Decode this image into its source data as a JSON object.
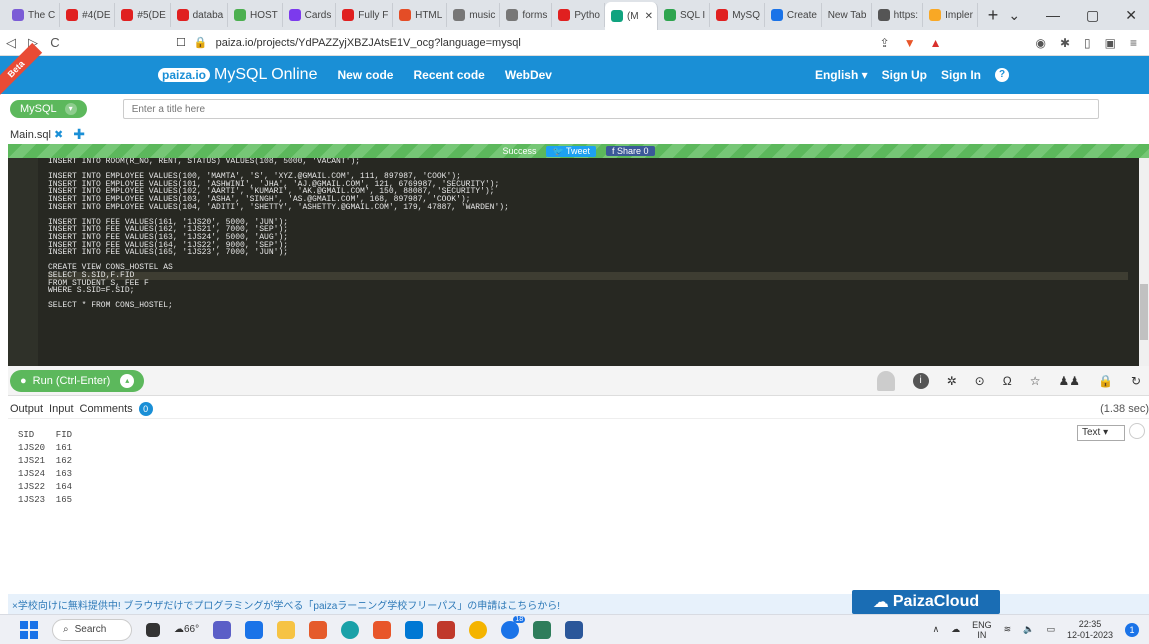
{
  "browser": {
    "tabs": [
      {
        "label": "The C",
        "color": "#7b5cd6"
      },
      {
        "label": "#4(DE",
        "color": "#e02020"
      },
      {
        "label": "#5(DE",
        "color": "#e02020"
      },
      {
        "label": "databa",
        "color": "#e02020"
      },
      {
        "label": "HOST",
        "color": "#4caf50"
      },
      {
        "label": "Cards",
        "color": "#7c3aed"
      },
      {
        "label": "Fully F",
        "color": "#e02020"
      },
      {
        "label": "HTML",
        "color": "#e44d26"
      },
      {
        "label": "music",
        "color": "#777777"
      },
      {
        "label": "forms",
        "color": "#777777"
      },
      {
        "label": "Pytho",
        "color": "#e02020"
      },
      {
        "label": "(M",
        "color": "#10a37f",
        "active": true
      },
      {
        "label": "SQL I",
        "color": "#2ea44f"
      },
      {
        "label": "MySQ",
        "color": "#e02020"
      },
      {
        "label": "Create",
        "color": "#1a73e8"
      },
      {
        "label": "New Tab",
        "color": ""
      },
      {
        "label": "https:",
        "color": "#555555"
      },
      {
        "label": "Impler",
        "color": "#f9a825"
      }
    ],
    "new_tab": "+",
    "window_controls": [
      "⌄",
      "—",
      "▢",
      "✕"
    ],
    "url": "paiza.io/projects/YdPAZZyjXBZJAtsE1V_ocg?language=mysql"
  },
  "paiza": {
    "beta": "Beta",
    "logo": "paiza.io",
    "title": "MySQL Online",
    "nav": [
      "New code",
      "Recent code",
      "WebDev"
    ],
    "lang_menu": "English ▾",
    "signup": "Sign Up",
    "signin": "Sign In",
    "help": "?"
  },
  "editor_bar": {
    "language": "MySQL",
    "title_placeholder": "Enter a title here",
    "file_name": "Main.sql",
    "success": "Success",
    "tweet": "Tweet",
    "share": "Share 0"
  },
  "code": [
    "INSERT INTO ROOM(R_NO, RENT, STATUS) VALUES(108, 5000, 'VACANT');",
    "",
    "INSERT INTO EMPLOYEE VALUES(100, 'MAMTA', 'S', 'XYZ.@GMAIL.COM', 111, 897987, 'COOK');",
    "INSERT INTO EMPLOYEE VALUES(101, 'ASHWINI', 'JHA', 'AJ.@GMAIL.COM', 121, 6769987, 'SECURITY');",
    "INSERT INTO EMPLOYEE VALUES(102, 'AARTI', 'KUMARI', 'AK.@GMAIL.COM', 150, 88087, 'SECURITY');",
    "INSERT INTO EMPLOYEE VALUES(103, 'ASHA', 'SINGH', 'AS.@GMAIL.COM', 168, 897987, 'COOK');",
    "INSERT INTO EMPLOYEE VALUES(104, 'ADITI', 'SHETTY', 'ASHETTY.@GMAIL.COM', 179, 47887, 'WARDEN');",
    "",
    "INSERT INTO FEE VALUES(161, '1JS20', 5000, 'JUN');",
    "INSERT INTO FEE VALUES(162, '1JS21', 7000, 'SEP');",
    "INSERT INTO FEE VALUES(163, '1JS24', 5000, 'AUG');",
    "INSERT INTO FEE VALUES(164, '1JS22', 9000, 'SEP');",
    "INSERT INTO FEE VALUES(165, '1JS23', 7000, 'JUN');",
    "",
    "CREATE VIEW CONS_HOSTEL AS",
    "SELECT S.SID,F.FID",
    "FROM STUDENT S, FEE F",
    "WHERE S.SID=F.SID;",
    "",
    "SELECT * FROM CONS_HOSTEL;"
  ],
  "run": {
    "label": "Run (Ctrl-Enter)"
  },
  "output": {
    "tabs": [
      "Output",
      "Input",
      "Comments"
    ],
    "comments_count": "0",
    "time": "(1.38 sec)",
    "format": "Text",
    "header": "SID    FID",
    "rows": [
      "1JS20  161",
      "1JS21  162",
      "1JS24  163",
      "1JS22  164",
      "1JS23  165"
    ]
  },
  "banner": {
    "text": "×学校向けに無料提供中! ブラウザだけでプログラミングが学べる「paizaラーニング学校フリーパス」の申請はこちらから!",
    "cloud": "PaizaCloud"
  },
  "taskbar": {
    "search": "Search",
    "weather": "66°",
    "badge": "18",
    "lang_top": "ENG",
    "lang_bottom": "IN",
    "time": "22:35",
    "date": "12-01-2023",
    "notifications": "1"
  }
}
